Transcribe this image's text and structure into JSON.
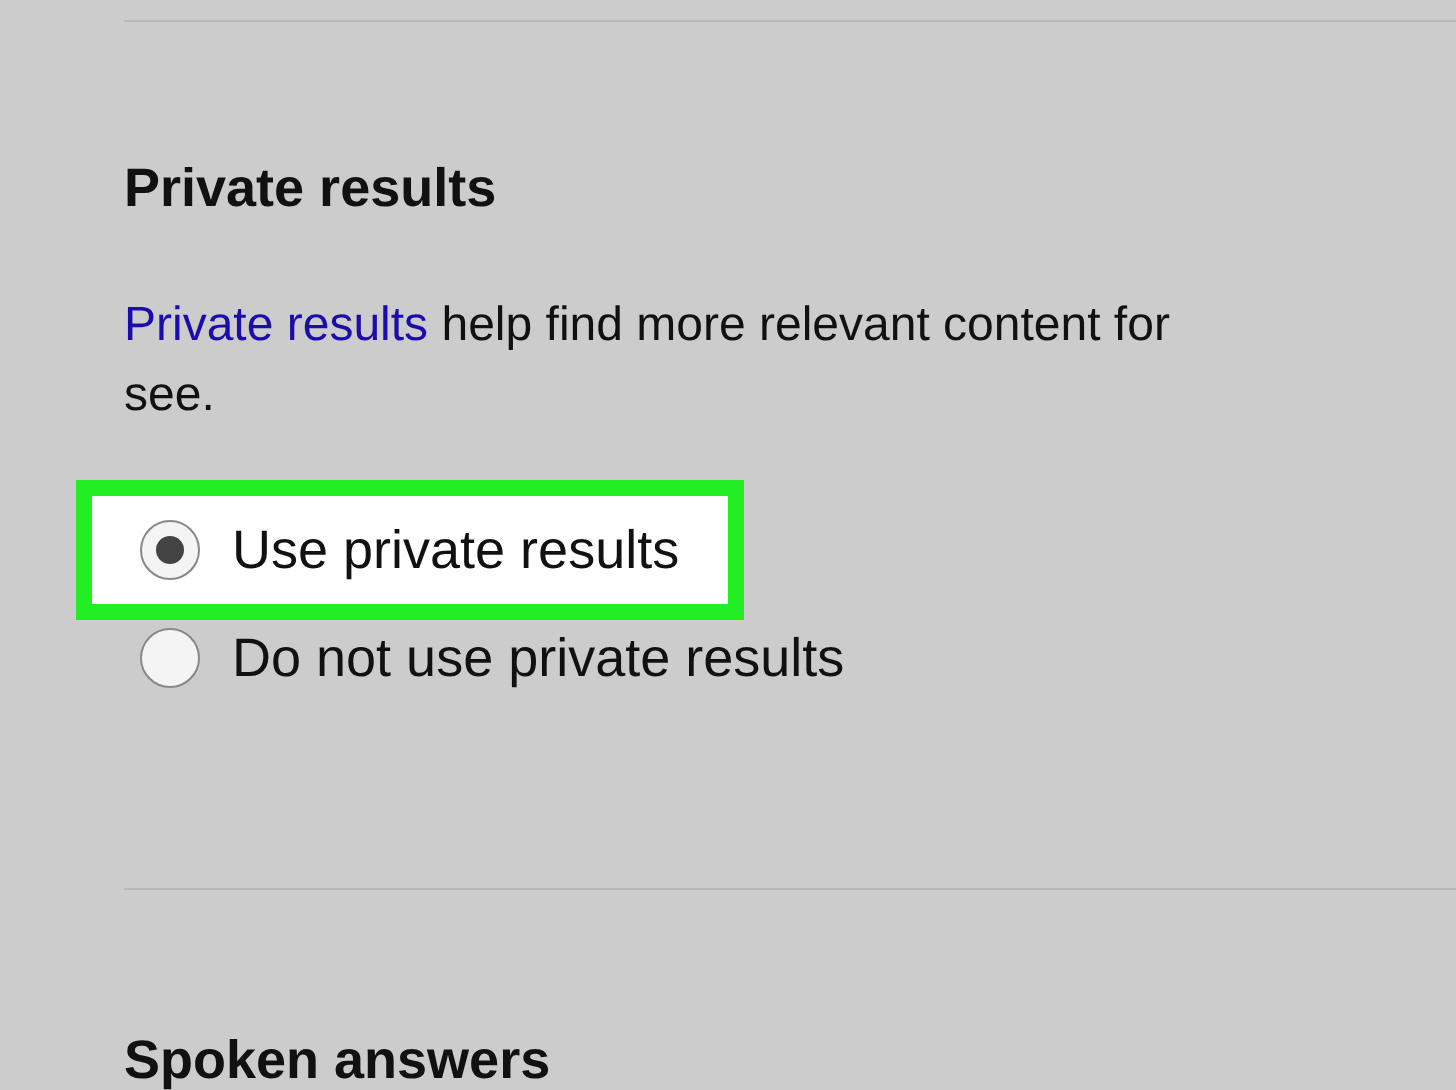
{
  "sections": [
    {
      "heading": "Private results",
      "description": {
        "link": "Private results",
        "text": " help find more relevant content for",
        "continuation": "see."
      },
      "options": [
        {
          "label": "Use private results",
          "selected": true,
          "highlighted": true
        },
        {
          "label": "Do not use private results",
          "selected": false,
          "highlighted": false
        }
      ]
    },
    {
      "heading": "Spoken answers"
    }
  ]
}
